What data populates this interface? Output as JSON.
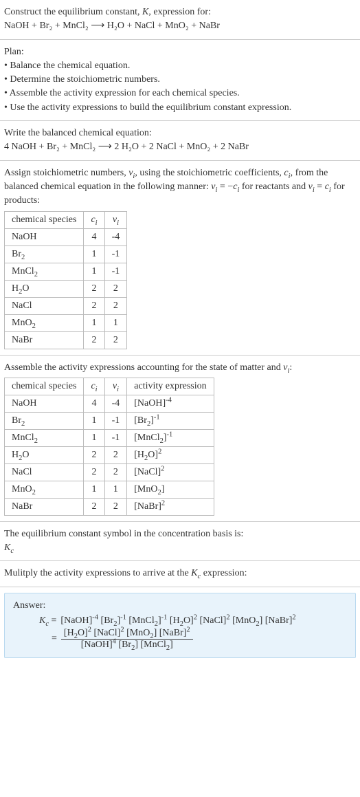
{
  "intro": {
    "construct": "Construct the equilibrium constant, K, expression for:",
    "reaction": "NaOH + Br₂ + MnCl₂ ⟶ H₂O + NaCl + MnO₂ + NaBr"
  },
  "plan": {
    "title": "Plan:",
    "items": [
      "• Balance the chemical equation.",
      "• Determine the stoichiometric numbers.",
      "• Assemble the activity expression for each chemical species.",
      "• Use the activity expressions to build the equilibrium constant expression."
    ]
  },
  "balanced": {
    "title": "Write the balanced chemical equation:",
    "eq": "4 NaOH + Br₂ + MnCl₂ ⟶ 2 H₂O + 2 NaCl + MnO₂ + 2 NaBr"
  },
  "stoich": {
    "intro": "Assign stoichiometric numbers, νᵢ, using the stoichiometric coefficients, cᵢ, from the balanced chemical equation in the following manner: νᵢ = −cᵢ for reactants and νᵢ = cᵢ for products:",
    "headers": [
      "chemical species",
      "cᵢ",
      "νᵢ"
    ],
    "rows": [
      {
        "sp": "NaOH",
        "c": "4",
        "v": "-4"
      },
      {
        "sp": "Br₂",
        "c": "1",
        "v": "-1"
      },
      {
        "sp": "MnCl₂",
        "c": "1",
        "v": "-1"
      },
      {
        "sp": "H₂O",
        "c": "2",
        "v": "2"
      },
      {
        "sp": "NaCl",
        "c": "2",
        "v": "2"
      },
      {
        "sp": "MnO₂",
        "c": "1",
        "v": "1"
      },
      {
        "sp": "NaBr",
        "c": "2",
        "v": "2"
      }
    ]
  },
  "activity": {
    "intro": "Assemble the activity expressions accounting for the state of matter and νᵢ:",
    "headers": [
      "chemical species",
      "cᵢ",
      "νᵢ",
      "activity expression"
    ],
    "rows": [
      {
        "sp": "NaOH",
        "c": "4",
        "v": "-4",
        "ae_base": "[NaOH]",
        "ae_exp": "-4"
      },
      {
        "sp": "Br₂",
        "c": "1",
        "v": "-1",
        "ae_base": "[Br₂]",
        "ae_exp": "-1"
      },
      {
        "sp": "MnCl₂",
        "c": "1",
        "v": "-1",
        "ae_base": "[MnCl₂]",
        "ae_exp": "-1"
      },
      {
        "sp": "H₂O",
        "c": "2",
        "v": "2",
        "ae_base": "[H₂O]",
        "ae_exp": "2"
      },
      {
        "sp": "NaCl",
        "c": "2",
        "v": "2",
        "ae_base": "[NaCl]",
        "ae_exp": "2"
      },
      {
        "sp": "MnO₂",
        "c": "1",
        "v": "1",
        "ae_base": "[MnO₂]",
        "ae_exp": ""
      },
      {
        "sp": "NaBr",
        "c": "2",
        "v": "2",
        "ae_base": "[NaBr]",
        "ae_exp": "2"
      }
    ]
  },
  "symbol": {
    "title": "The equilibrium constant symbol in the concentration basis is:",
    "sym": "K_c"
  },
  "multiply": {
    "title": "Mulitply the activity expressions to arrive at the K_c expression:"
  },
  "answer": {
    "label": "Answer:",
    "kc": "K_c",
    "line1_terms": [
      "[NaOH]^-4",
      "[Br₂]^-1",
      "[MnCl₂]^-1",
      "[H₂O]^2",
      "[NaCl]^2",
      "[MnO₂]",
      "[NaBr]^2"
    ],
    "num_terms": [
      "[H₂O]^2",
      "[NaCl]^2",
      "[MnO₂]",
      "[NaBr]^2"
    ],
    "den_terms": [
      "[NaOH]^4",
      "[Br₂]",
      "[MnCl₂]"
    ]
  }
}
